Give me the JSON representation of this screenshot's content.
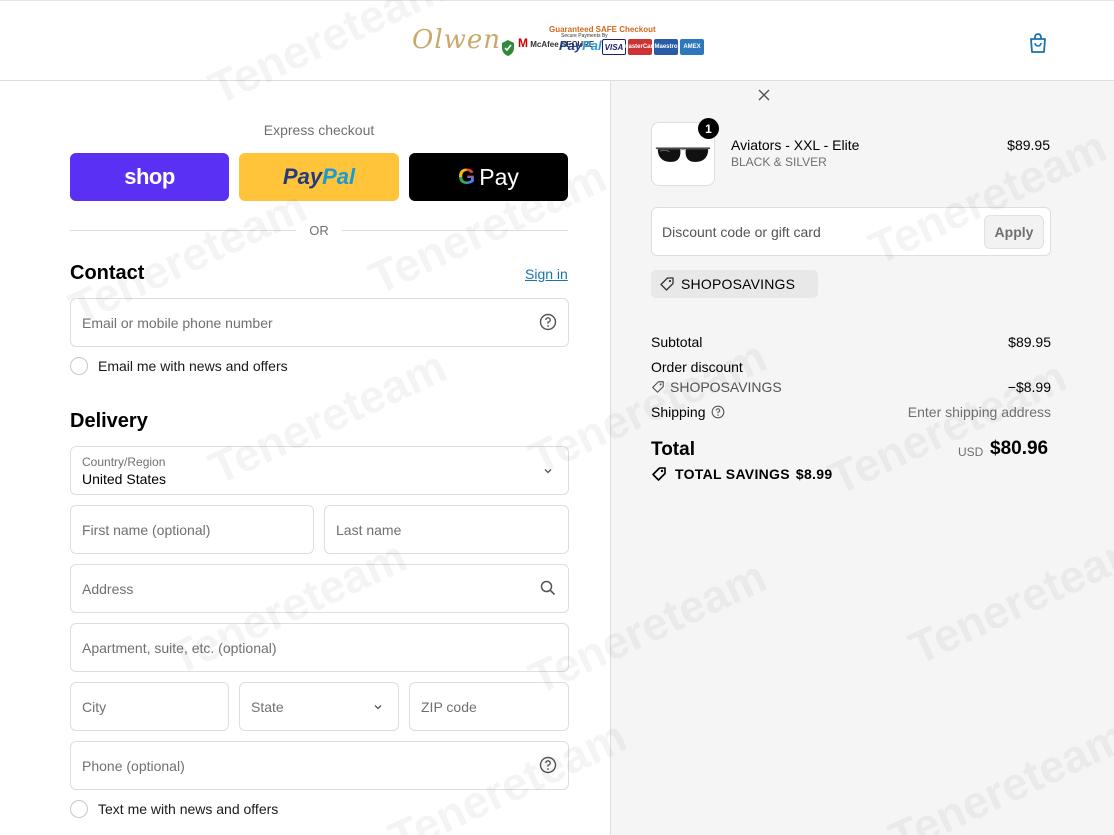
{
  "header": {
    "brand_logo": "Olwen",
    "trust_badge_title": "Guaranteed SAFE Checkout",
    "mcafee_label": "McAfee SECURE",
    "paypal_small": "Secure Payments By",
    "paypal_pay": "Pay",
    "paypal_pal": "Pal",
    "cards": [
      "VISA",
      "MasterCard",
      "Maestro",
      "AMEX"
    ],
    "cart_icon": "shopping-bag-icon"
  },
  "express": {
    "label": "Express checkout",
    "shop_label": "shop",
    "paypal_pay": "Pay",
    "paypal_pal": "Pal",
    "gpay_g": "G",
    "gpay_label": "Pay",
    "or_label": "OR"
  },
  "contact": {
    "title": "Contact",
    "sign_in": "Sign in",
    "email_placeholder": "Email or mobile phone number",
    "email_optin": "Email me with news and offers"
  },
  "delivery": {
    "title": "Delivery",
    "country_label": "Country/Region",
    "country_value": "United States",
    "first_name": "First name (optional)",
    "last_name": "Last name",
    "address": "Address",
    "apartment": "Apartment, suite, etc. (optional)",
    "city": "City",
    "state": "State",
    "zip": "ZIP code",
    "phone": "Phone (optional)",
    "sms_optin": "Text me with news and offers"
  },
  "summary": {
    "product": {
      "name": "Aviators - XXL - Elite",
      "variant": "BLACK & SILVER",
      "price": "$89.95",
      "quantity": "1"
    },
    "discount_placeholder": "Discount code or gift card",
    "apply_label": "Apply",
    "applied_code": "SHOPOSAVINGS",
    "subtotal_label": "Subtotal",
    "subtotal_value": "$89.95",
    "order_discount_label": "Order discount",
    "discount_code": "SHOPOSAVINGS",
    "discount_value": "−$8.99",
    "shipping_label": "Shipping",
    "shipping_value": "Enter shipping address",
    "total_label": "Total",
    "currency": "USD",
    "total_value": "$80.96",
    "savings_label": "TOTAL SAVINGS",
    "savings_value": "$8.99"
  },
  "watermark": "Tenereteam",
  "colors": {
    "shop_purple": "#5a31f4",
    "paypal_yellow": "#ffc439",
    "link_blue": "#1773b0"
  }
}
